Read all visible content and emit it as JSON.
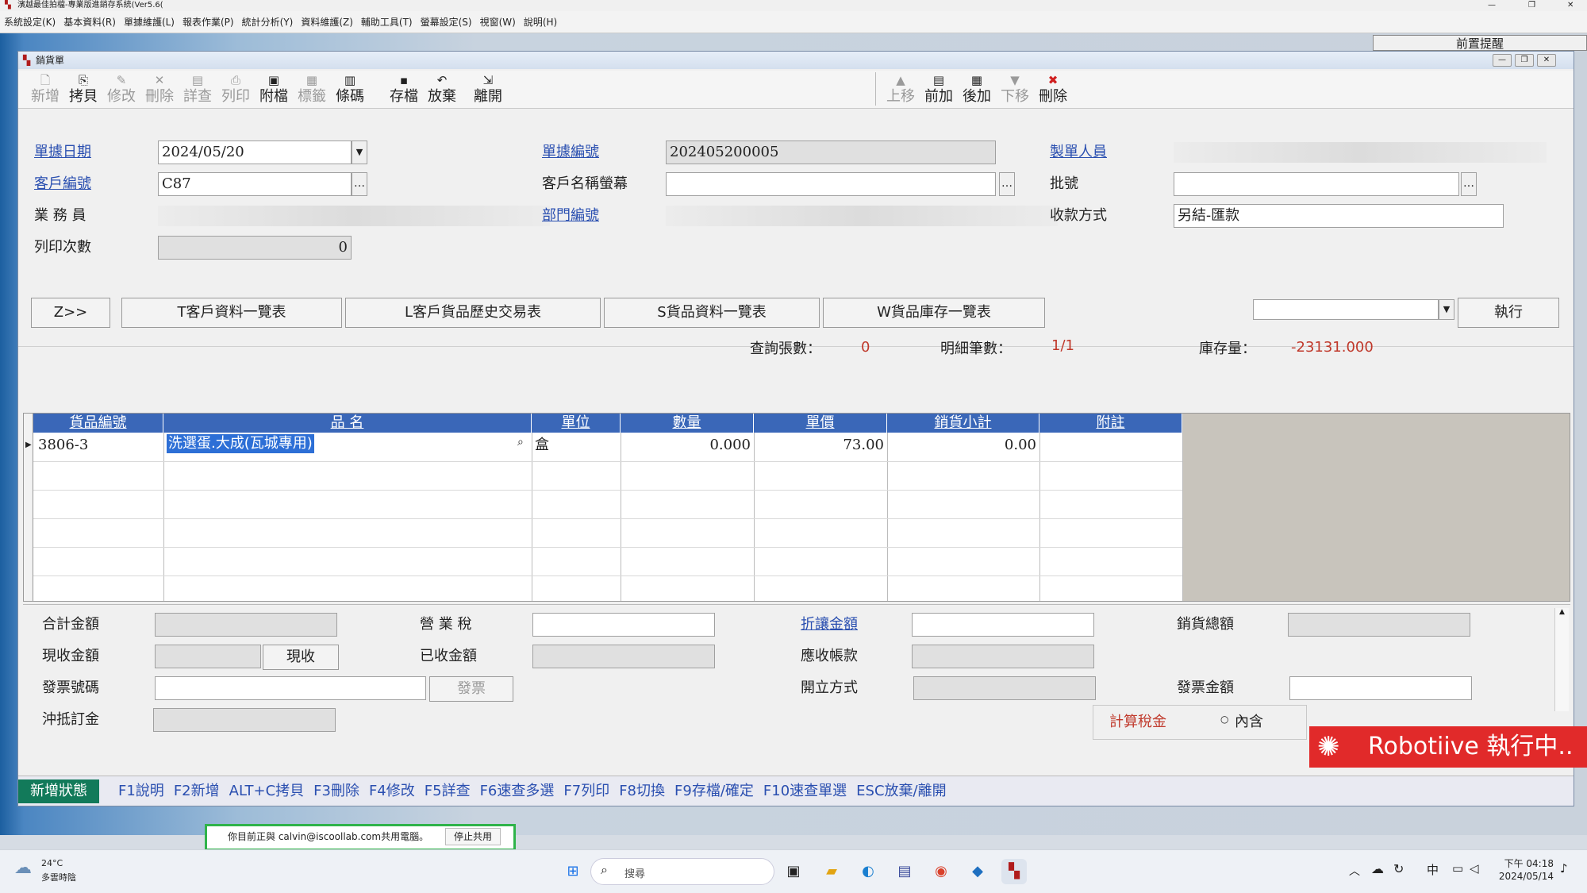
{
  "app": {
    "title": "濱越最佳拍檔-專業版進銷存系統(Ver5.6(",
    "menu": [
      "系統設定(K)",
      "基本資料(R)",
      "單據維護(L)",
      "報表作業(P)",
      "統計分析(Y)",
      "資料維護(Z)",
      "輔助工具(T)",
      "螢幕設定(S)",
      "視窗(W)",
      "說明(H)"
    ],
    "bg_tab": "前置提醒"
  },
  "window": {
    "title": "銷貨單",
    "toolbar": {
      "left": [
        {
          "label": "新增",
          "icon": "🗋",
          "enabled": false
        },
        {
          "label": "拷貝",
          "icon": "⎘",
          "enabled": true
        },
        {
          "label": "修改",
          "icon": "✎",
          "enabled": false
        },
        {
          "label": "刪除",
          "icon": "✕",
          "enabled": false
        },
        {
          "label": "詳查",
          "icon": "▤",
          "enabled": false
        },
        {
          "label": "列印",
          "icon": "⎙",
          "enabled": false
        },
        {
          "label": "附檔",
          "icon": "▣",
          "enabled": true
        },
        {
          "label": "標籤",
          "icon": "▦",
          "enabled": false
        },
        {
          "label": "條碼",
          "icon": "▥",
          "enabled": true
        },
        {
          "label": "存檔",
          "icon": "▪",
          "enabled": true
        },
        {
          "label": "放棄",
          "icon": "↶",
          "enabled": true
        },
        {
          "label": "離開",
          "icon": "⇲",
          "enabled": true
        }
      ],
      "right": [
        {
          "label": "上移",
          "icon": "▲",
          "enabled": false
        },
        {
          "label": "前加",
          "icon": "▤",
          "enabled": true
        },
        {
          "label": "後加",
          "icon": "▦",
          "enabled": true
        },
        {
          "label": "下移",
          "icon": "▼",
          "enabled": false
        },
        {
          "label": "刪除",
          "icon": "✖",
          "enabled": true
        }
      ]
    },
    "form": {
      "doc_date_label": "單據日期",
      "doc_date": "2024/05/20",
      "customer_no_label": "客戶編號",
      "customer_no": "C87",
      "salesperson_label": "業 務 員",
      "print_count_label": "列印次數",
      "print_count": "0",
      "doc_no_label": "單據編號",
      "doc_no": "202405200005",
      "customer_name_label": "客戶名稱螢幕",
      "dept_label": "部門編號",
      "creator_label": "製單人員",
      "batch_label": "批號",
      "payment_label": "收款方式",
      "payment_value": "另結-匯款"
    },
    "query_buttons": [
      "Z>>",
      "T客戶資料一覽表",
      "L客戶貨品歷史交易表",
      "S貨品資料一覽表",
      "W貨品庫存一覽表"
    ],
    "execute_label": "執行",
    "stats": {
      "query_count_label": "查詢張數：",
      "query_count": "0",
      "detail_count_label": "明細筆數：",
      "detail_count": "1/1",
      "stock_label": "庫存量：",
      "stock": "-23131.000"
    },
    "grid": {
      "columns": [
        "貨品編號",
        "品 名",
        "單位",
        "數量",
        "單價",
        "銷貨小計",
        "附註"
      ],
      "rows": [
        {
          "code": "3806-3",
          "name": "洗選蛋.大成(瓦城專用)",
          "unit": "盒",
          "qty": "0.000",
          "price": "73.00",
          "subtotal": "0.00",
          "note": ""
        }
      ]
    },
    "totals": {
      "total_label": "合計金額",
      "received_now_label": "現收金額",
      "received_now_btn": "現收",
      "invoice_no_label": "發票號碼",
      "invoice_btn": "發票",
      "deposit_label": "沖抵訂金",
      "tax_label": "營 業 稅",
      "received_label": "已收金額",
      "discount_label": "折讓金額",
      "receivable_label": "應收帳款",
      "issue_method_label": "開立方式",
      "sales_total_label": "銷貨總額",
      "invoice_amount_label": "發票金額",
      "calc_tax_label": "計算稅金",
      "tax_included_label": "內含"
    },
    "status": "新增狀態",
    "hotkeys": [
      "F1說明",
      "F2新增",
      "ALT+C拷貝",
      "F3刪除",
      "F4修改",
      "F5詳查",
      "F6速查多選",
      "F7列印",
      "F8切換",
      "F9存檔/確定",
      "F10速查單選",
      "ESC放棄/離開"
    ]
  },
  "overlay": {
    "robotiive": "Robotiive 執行中..",
    "share_text": "你目前正與 calvin@iscoollab.com共用電腦。",
    "share_btn": "停止共用"
  },
  "taskbar": {
    "weather_temp": "24°C",
    "weather_desc": "多雲時陰",
    "search": "搜尋",
    "ime": "中",
    "time": "下午 04:18",
    "date": "2024/05/14"
  }
}
